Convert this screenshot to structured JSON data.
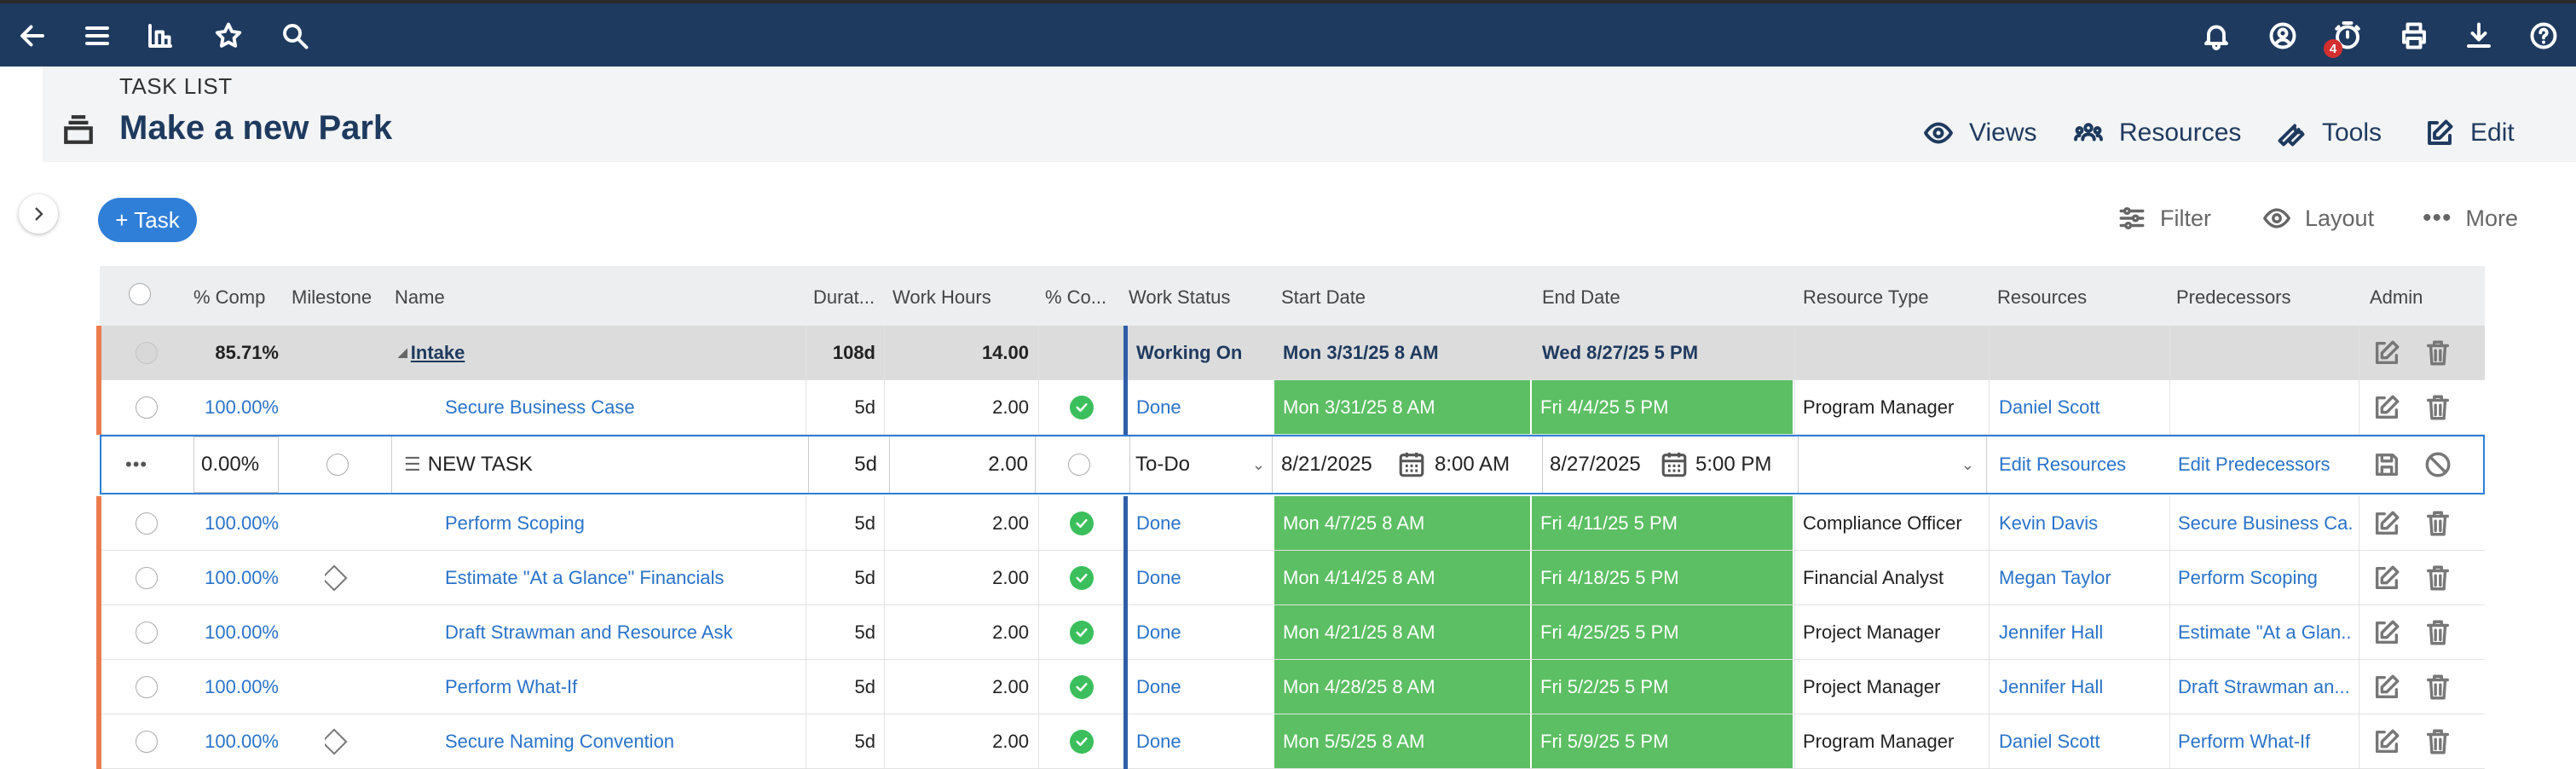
{
  "topbar": {
    "icons_left": [
      "back-arrow-icon",
      "menu-icon",
      "dashboard-icon",
      "star-icon",
      "search-icon"
    ],
    "icons_right": [
      "bell-icon",
      "user-circle-icon",
      "timer-icon",
      "printer-icon",
      "download-icon",
      "help-icon"
    ],
    "timer_badge": "4",
    "bg_color": "#1e3a5f"
  },
  "header": {
    "eyebrow": "TASK LIST",
    "title": "Make a new Park",
    "actions": [
      {
        "label": "Views",
        "icon": "eye-icon"
      },
      {
        "label": "Resources",
        "icon": "people-icon"
      },
      {
        "label": "Tools",
        "icon": "wrench-icon"
      },
      {
        "label": "Edit",
        "icon": "edit-icon"
      }
    ]
  },
  "toolbar": {
    "add_task_label": "+ Task",
    "filter_label": "Filter",
    "layout_label": "Layout",
    "more_label": "More"
  },
  "columns": [
    "% Comp",
    "Milestone",
    "Name",
    "Durat...",
    "Work Hours",
    "% Co...",
    "Work Status",
    "Start Date",
    "End Date",
    "Resource Type",
    "Resources",
    "Predecessors",
    "Admin"
  ],
  "summary_row": {
    "pct": "85.71%",
    "name": "Intake",
    "duration": "108d",
    "hours": "14.00",
    "status": "Working On",
    "start": "Mon 3/31/25 8 AM",
    "end": "Wed 8/27/25 5 PM"
  },
  "rows_before": [
    {
      "pct": "100.00%",
      "milestone": false,
      "name": "Secure Business Case",
      "duration": "5d",
      "hours": "2.00",
      "status": "Done",
      "start": "Mon 3/31/25 8 AM",
      "end": "Fri 4/4/25 5 PM",
      "rtype": "Program Manager",
      "resource": "Daniel Scott",
      "pred": ""
    }
  ],
  "edit_row": {
    "pct": "0.00%",
    "name": "NEW TASK",
    "duration": "5d",
    "hours": "2.00",
    "status": "To-Do",
    "start_date": "8/21/2025",
    "start_time": "8:00 AM",
    "end_date": "8/27/2025",
    "end_time": "5:00 PM",
    "resources_link": "Edit Resources",
    "pred_link": "Edit Predecessors"
  },
  "rows_after": [
    {
      "pct": "100.00%",
      "milestone": false,
      "name": "Perform Scoping",
      "duration": "5d",
      "hours": "2.00",
      "status": "Done",
      "start": "Mon 4/7/25 8 AM",
      "end": "Fri 4/11/25 5 PM",
      "rtype": "Compliance Officer",
      "resource": "Kevin Davis",
      "pred": "Secure Business Ca..."
    },
    {
      "pct": "100.00%",
      "milestone": true,
      "name": "Estimate \"At a Glance\" Financials",
      "duration": "5d",
      "hours": "2.00",
      "status": "Done",
      "start": "Mon 4/14/25 8 AM",
      "end": "Fri 4/18/25 5 PM",
      "rtype": "Financial Analyst",
      "resource": "Megan Taylor",
      "pred": "Perform Scoping"
    },
    {
      "pct": "100.00%",
      "milestone": false,
      "name": "Draft Strawman and Resource Ask",
      "duration": "5d",
      "hours": "2.00",
      "status": "Done",
      "start": "Mon 4/21/25 8 AM",
      "end": "Fri 4/25/25 5 PM",
      "rtype": "Project Manager",
      "resource": "Jennifer Hall",
      "pred": "Estimate \"At a Glan..."
    },
    {
      "pct": "100.00%",
      "milestone": false,
      "name": "Perform What-If",
      "duration": "5d",
      "hours": "2.00",
      "status": "Done",
      "start": "Mon 4/28/25 8 AM",
      "end": "Fri 5/2/25 5 PM",
      "rtype": "Project Manager",
      "resource": "Jennifer Hall",
      "pred": "Draft Strawman an..."
    },
    {
      "pct": "100.00%",
      "milestone": true,
      "name": "Secure Naming Convention",
      "duration": "5d",
      "hours": "2.00",
      "status": "Done",
      "start": "Mon 5/5/25 8 AM",
      "end": "Fri 5/9/25 5 PM",
      "rtype": "Program Manager",
      "resource": "Daniel Scott",
      "pred": "Perform What-If"
    }
  ],
  "colors": {
    "done_green": "#5cbf63",
    "link": "#2a73c9",
    "accent_orange": "#ec7b4d",
    "primary": "#2f7fd8"
  }
}
